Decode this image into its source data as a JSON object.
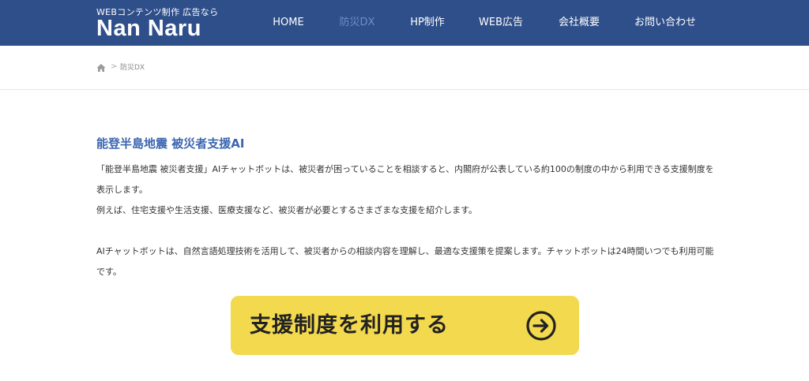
{
  "header": {
    "logo_sub": "WEBコンテンツ制作 広告なら",
    "logo_main": "Nan Naru",
    "bg_color": "#2f4f8a"
  },
  "nav": {
    "items": [
      {
        "label": "HOME",
        "active": false
      },
      {
        "label": "防災DX",
        "active": true
      },
      {
        "label": "HP制作",
        "active": false
      },
      {
        "label": "WEB広告",
        "active": false
      },
      {
        "label": "会社概要",
        "active": false
      },
      {
        "label": "お問い合わせ",
        "active": false
      }
    ],
    "active_color": "#6f8fc9"
  },
  "breadcrumb": {
    "home_icon": "home-icon",
    "separator": ">",
    "current": "防災DX"
  },
  "content": {
    "title": "能登半島地震 被災者支援AI",
    "paragraph1": "「能登半島地震 被災者支援」AIチャットボットは、被災者が困っていることを相談すると、内閣府が公表している約100の制度の中から利用できる支援制度を表示します。",
    "paragraph2": "例えば、住宅支援や生活支援、医療支援など、被災者が必要とするさまざまな支援を紹介します。",
    "paragraph3": "AIチャットボットは、自然言語処理技術を活用して、被災者からの相談内容を理解し、最適な支援策を提案します。チャットボットは24時間いつでも利用可能です。",
    "title_color": "#3c66b0"
  },
  "cta": {
    "label": "支援制度を利用する",
    "icon": "arrow-right-circle-icon",
    "bg_color": "#f2d94e"
  }
}
